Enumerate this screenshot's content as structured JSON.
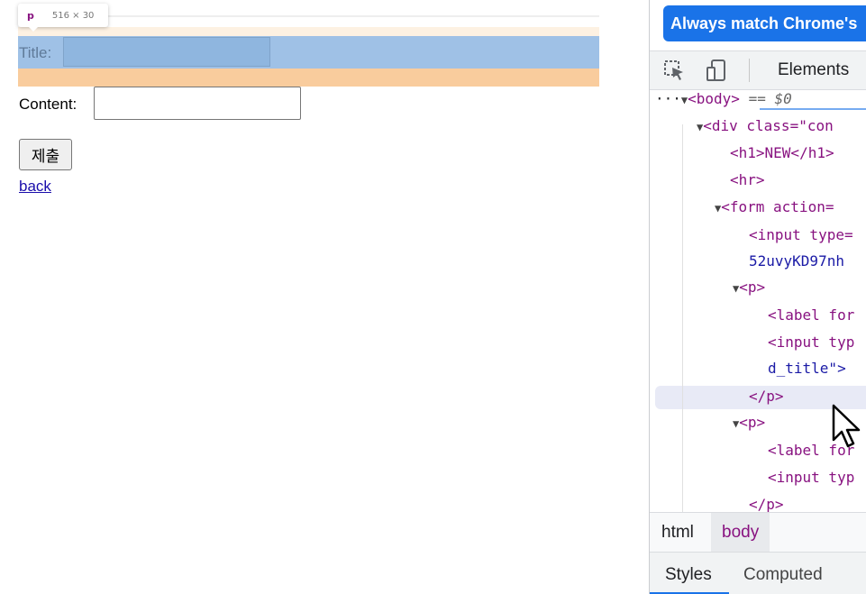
{
  "page": {
    "tooltip": {
      "tag": "p",
      "size": "516 × 30"
    },
    "title_label": "Title:",
    "content_label": "Content:",
    "submit_label": "제출",
    "back_link": "back"
  },
  "devtools": {
    "banner": "Always match Chrome's",
    "tabs": {
      "elements": "Elements"
    },
    "dom": {
      "l0_prefix": "···",
      "l0_tag": "<body>",
      "l0_eq": " == $0",
      "l1": "<div class=\"con",
      "l2": "<h1>NEW</h1>",
      "l3": "<hr>",
      "l4": "<form action=",
      "l5": "<input type=",
      "l6": "52uvyKD97nh",
      "l7": "<p>",
      "l8": "<label for",
      "l9": "<input typ",
      "l10": "d_title\">",
      "l11": "</p>",
      "l12": "<p>",
      "l13": "<label for",
      "l14": "<input typ",
      "l15": "</p>"
    },
    "breadcrumbs": {
      "html": "html",
      "body": "body"
    },
    "bottom_tabs": {
      "styles": "Styles",
      "computed": "Computed"
    }
  },
  "colors": {
    "padding_highlight": "#9fc1e6",
    "margin_highlight": "#f9cc9d",
    "banner": "#1a73e8"
  }
}
